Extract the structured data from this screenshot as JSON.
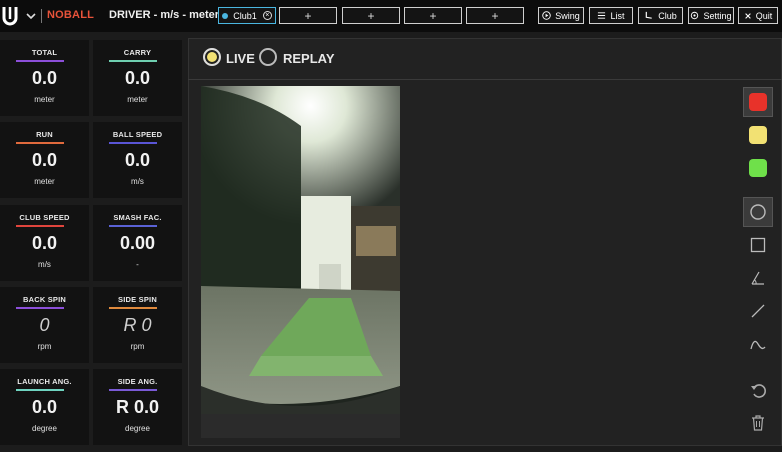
{
  "topbar": {
    "brand_label": "NOBALL",
    "title": "DRIVER - m/s - meter",
    "active_club": "Club1",
    "add_slot": "+",
    "buttons": {
      "swing": "Swing",
      "list": "List",
      "club": "Club",
      "setting": "Setting",
      "quit": "Quit"
    }
  },
  "stats": [
    {
      "label": "TOTAL",
      "value": "0.0",
      "unit": "meter",
      "color": "#8c4fd9"
    },
    {
      "label": "CARRY",
      "value": "0.0",
      "unit": "meter",
      "color": "#6fcfb0"
    },
    {
      "label": "RUN",
      "value": "0.0",
      "unit": "meter",
      "color": "#e06a3d"
    },
    {
      "label": "BALL SPEED",
      "value": "0.0",
      "unit": "m/s",
      "color": "#5a55d6"
    },
    {
      "label": "CLUB SPEED",
      "value": "0.0",
      "unit": "m/s",
      "color": "#e0453d"
    },
    {
      "label": "SMASH FAC.",
      "value": "0.00",
      "unit": "-",
      "color": "#5a62d6"
    },
    {
      "label": "BACK SPIN",
      "value": "0",
      "unit": "rpm",
      "color": "#8c4fd9"
    },
    {
      "label": "SIDE SPIN",
      "value": "R 0",
      "unit": "rpm",
      "color": "#e08a3d"
    },
    {
      "label": "LAUNCH ANG.",
      "value": "0.0",
      "unit": "degree",
      "color": "#6fd3c0"
    },
    {
      "label": "SIDE ANG.",
      "value": "R 0.0",
      "unit": "degree",
      "color": "#7a5ad6"
    }
  ],
  "mode": {
    "live": "LIVE",
    "replay": "REPLAY",
    "selected": "live"
  },
  "palette": {
    "red": "#e8322a",
    "yellow": "#f2e173",
    "green": "#6fe04a"
  },
  "tools": [
    "circle-icon",
    "square-icon",
    "angle-icon",
    "line-icon",
    "curve-icon",
    "undo-icon",
    "trash-icon"
  ]
}
